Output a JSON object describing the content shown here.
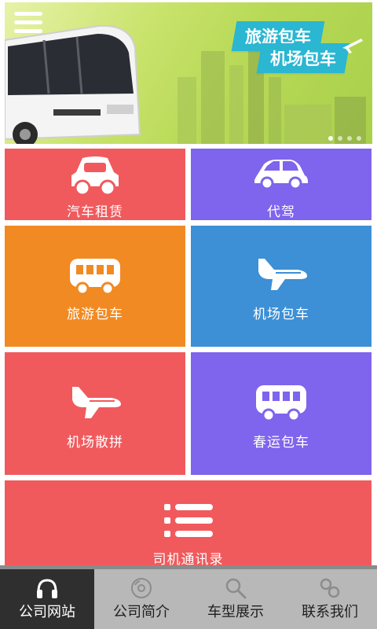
{
  "banner": {
    "promo_line1": "旅游包车",
    "promo_line2": "机场包车",
    "menu_icon": "hamburger-menu-icon"
  },
  "tiles": [
    {
      "label": "汽车租赁",
      "color": "#f05a5d",
      "icon": "car-icon"
    },
    {
      "label": "代驾",
      "color": "#7f64ed",
      "icon": "car-outline-icon"
    },
    {
      "label": "旅游包车",
      "color": "#f18a22",
      "icon": "bus-icon"
    },
    {
      "label": "机场包车",
      "color": "#3d8fd6",
      "icon": "airplane-icon"
    },
    {
      "label": "机场散拼",
      "color": "#f05a5d",
      "icon": "airplane-icon"
    },
    {
      "label": "春运包车",
      "color": "#7f64ed",
      "icon": "bus-icon"
    },
    {
      "label": "司机通讯录",
      "color": "#f05a5d",
      "icon": "list-icon"
    }
  ],
  "bottom_nav": [
    {
      "label": "公司网站",
      "icon": "headphones-icon",
      "active": true
    },
    {
      "label": "公司简介",
      "icon": "disc-icon",
      "active": false
    },
    {
      "label": "车型展示",
      "icon": "search-icon",
      "active": false
    },
    {
      "label": "联系我们",
      "icon": "link-icon",
      "active": false
    }
  ],
  "colors": {
    "nav_active": "#2f2f2f",
    "nav_bg": "#b8b8b8",
    "promo_bg": "#2bb6d1"
  }
}
